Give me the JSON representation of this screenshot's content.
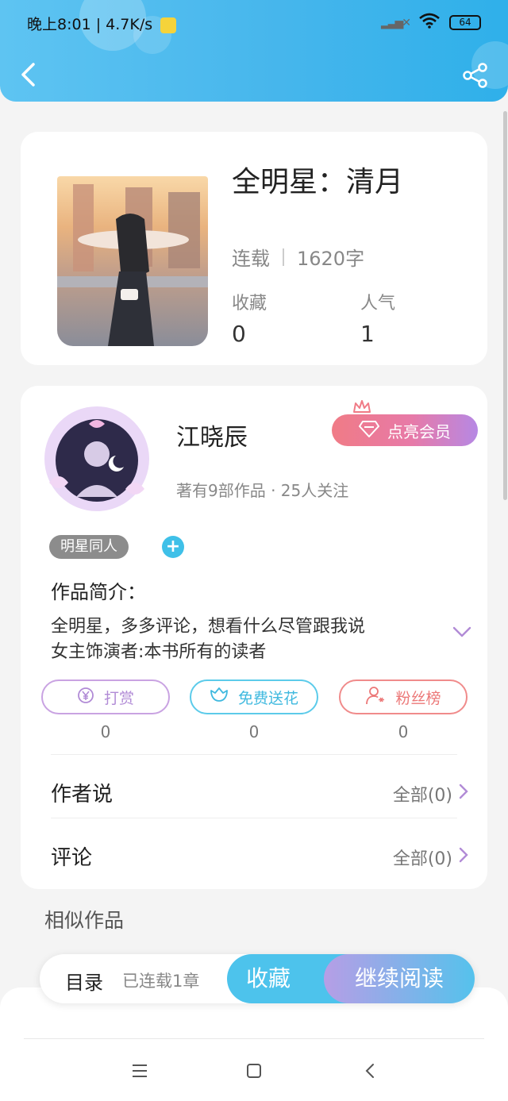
{
  "status_bar": {
    "time_speed": "晚上8:01 | 4.7K/s",
    "battery": "64"
  },
  "book": {
    "title": "全明星：清月",
    "status": "连载",
    "word_count": "1620字",
    "fav_label": "收藏",
    "fav_value": "0",
    "pop_label": "人气",
    "pop_value": "1"
  },
  "author": {
    "name": "江晓辰",
    "vip_label": "点亮会员",
    "meta": "著有9部作品 · 25人关注",
    "tag": "明星同人",
    "tag_add": "+"
  },
  "intro": {
    "label": "作品简介：",
    "line1": "全明星，多多评论，想看什么尽管跟我说",
    "line2": "女主饰演者:本书所有的读者"
  },
  "actions": {
    "reward_label": "打赏",
    "reward_count": "0",
    "flower_label": "免费送花",
    "flower_count": "0",
    "fans_label": "粉丝榜",
    "fans_count": "0"
  },
  "author_says": {
    "label": "作者说",
    "link": "全部(0)"
  },
  "comments": {
    "label": "评论",
    "link": "全部(0)"
  },
  "similar_label": "相似作品",
  "bottom_bar": {
    "toc_label": "目录",
    "toc_status": "已连载1章",
    "fav_button": "收藏",
    "read_button": "继续阅读"
  },
  "colors": {
    "header_blue": "#46b6ec",
    "accent_purple": "#b18bd6",
    "accent_cyan": "#3fb9df",
    "accent_red": "#ec7878"
  },
  "icons": [
    "back-icon",
    "share-icon",
    "wifi-icon",
    "signal-icon",
    "battery-icon",
    "diamond-icon",
    "crown-icon",
    "yen-icon",
    "flower-icon",
    "fans-icon",
    "chevron-down-icon",
    "chevron-right-icon",
    "menu-icon",
    "home-icon",
    "nav-back-icon"
  ]
}
